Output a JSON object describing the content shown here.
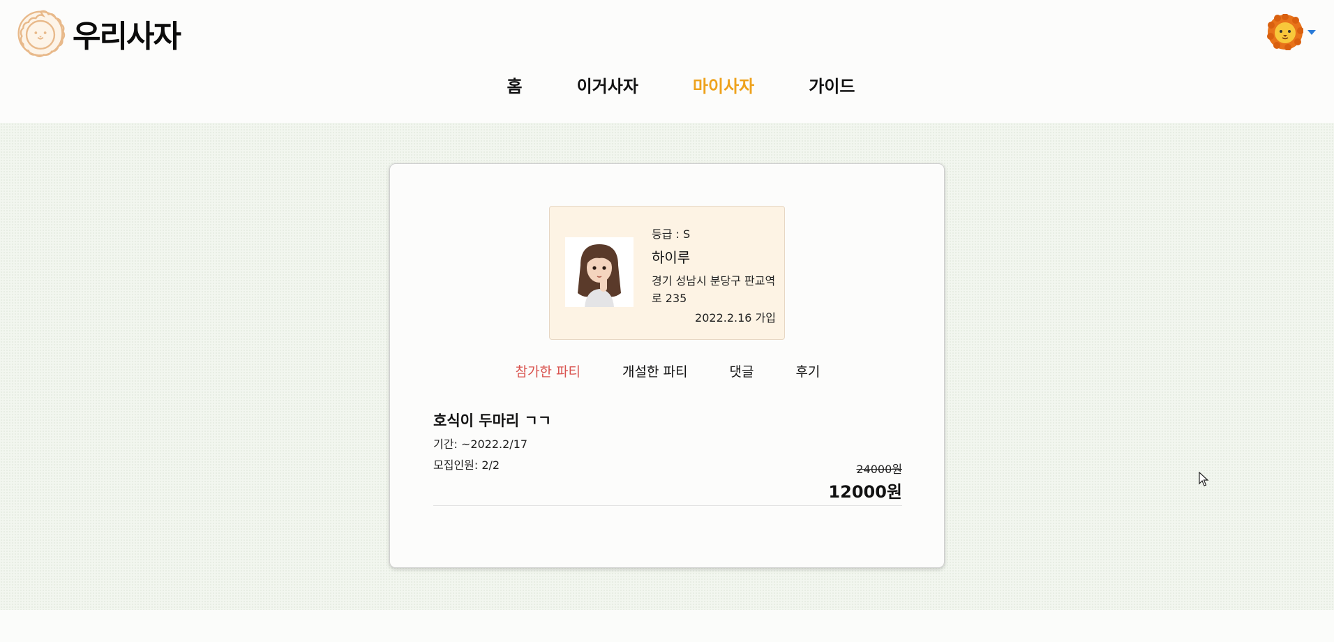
{
  "header": {
    "logo_text": "우리사자",
    "nav": [
      {
        "label": "홈",
        "active": false
      },
      {
        "label": "이거사자",
        "active": false
      },
      {
        "label": "마이사자",
        "active": true
      },
      {
        "label": "가이드",
        "active": false
      }
    ],
    "avatar_icon": "lion-avatar-icon",
    "caret_icon": "caret-down-icon"
  },
  "profile": {
    "grade": "등급 : S",
    "nickname": "하이루",
    "address": "경기 성남시 분당구 판교역로 235",
    "joined": "2022.2.16 가입"
  },
  "tabs": [
    {
      "label": "참가한 파티",
      "active": true
    },
    {
      "label": "개설한 파티",
      "active": false
    },
    {
      "label": "댓글",
      "active": false
    },
    {
      "label": "후기",
      "active": false
    }
  ],
  "parties": [
    {
      "title": "호식이 두마리 ㄱㄱ",
      "period": "기간: ~2022.2/17",
      "members": "모집인원: 2/2",
      "original_price": "24000원",
      "price": "12000원"
    }
  ],
  "colors": {
    "accent_nav": "#eea21c",
    "accent_tab": "#d9534f",
    "band_bg": "#f2f6ef",
    "profile_bg": "#fdf3e4"
  }
}
